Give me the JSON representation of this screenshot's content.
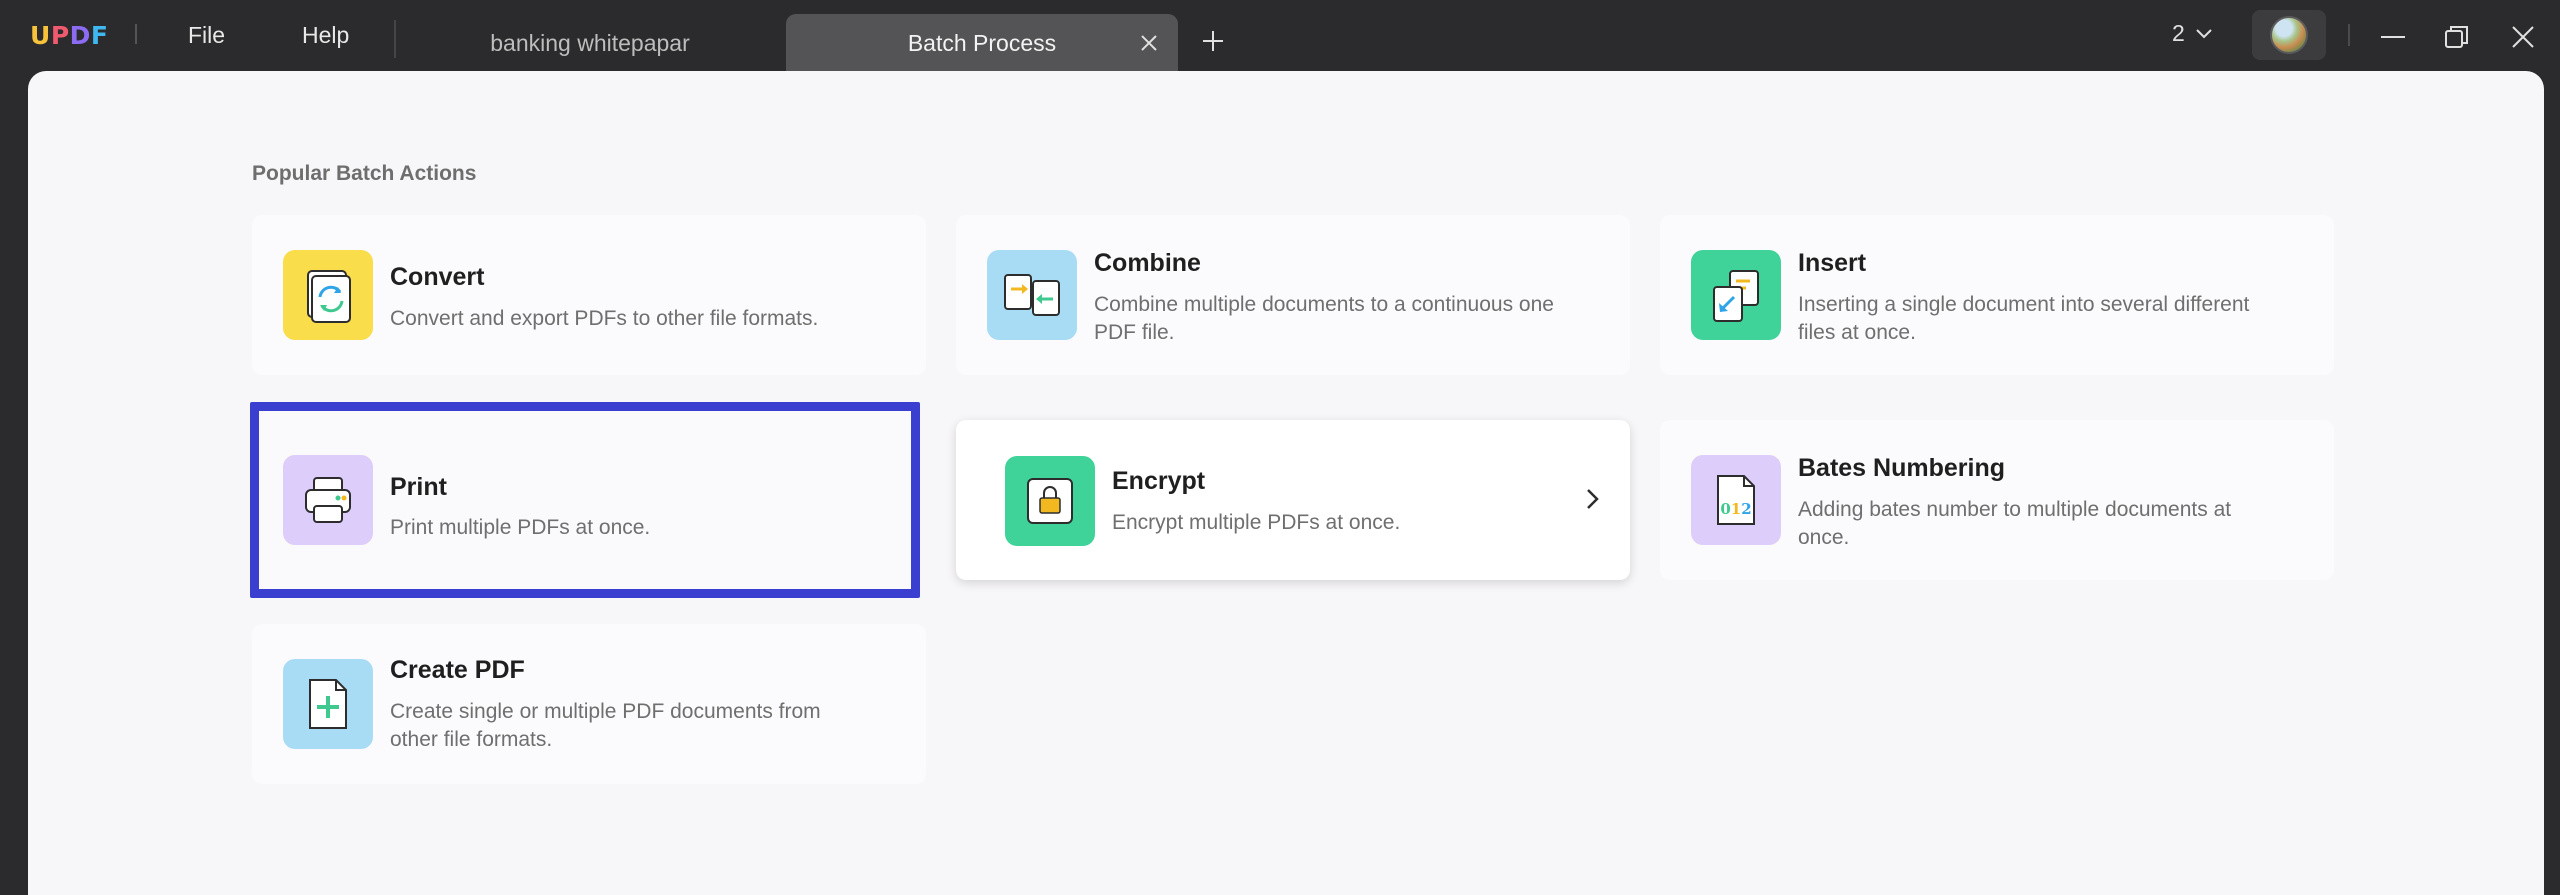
{
  "titlebar": {
    "logo": [
      "U",
      "P",
      "D",
      "F"
    ],
    "menu": {
      "file": "File",
      "help": "Help"
    },
    "tabs": [
      {
        "label": "banking whitepapar",
        "active": false
      },
      {
        "label": "Batch Process",
        "active": true
      }
    ],
    "page_count": "2"
  },
  "main": {
    "section_title": "Popular Batch Actions",
    "cards": [
      {
        "title": "Convert",
        "desc": "Convert and export PDFs to other file formats.",
        "icon": "convert-icon",
        "color": "#f9dd4a"
      },
      {
        "title": "Combine",
        "desc": "Combine multiple documents to a continuous one PDF file.",
        "icon": "combine-icon",
        "color": "#a8dcf5"
      },
      {
        "title": "Insert",
        "desc": "Inserting a single document into several different files at once.",
        "icon": "insert-icon",
        "color": "#3fd39a"
      },
      {
        "title": "Print",
        "desc": "Print multiple PDFs at once.",
        "icon": "print-icon",
        "color": "#dccdfa"
      },
      {
        "title": "Encrypt",
        "desc": "Encrypt multiple PDFs at once.",
        "icon": "lock-icon",
        "color": "#3fd39a"
      },
      {
        "title": "Bates Numbering",
        "desc": "Adding bates number to multiple documents at once.",
        "icon": "bates-icon",
        "color": "#dccdfa"
      },
      {
        "title": "Create PDF",
        "desc": "Create single or multiple PDF documents from other file formats.",
        "icon": "create-pdf-icon",
        "color": "#a8dcf5"
      }
    ],
    "selected_card": "Print",
    "hover_card": "Encrypt",
    "accent": "#3b3fd0"
  }
}
